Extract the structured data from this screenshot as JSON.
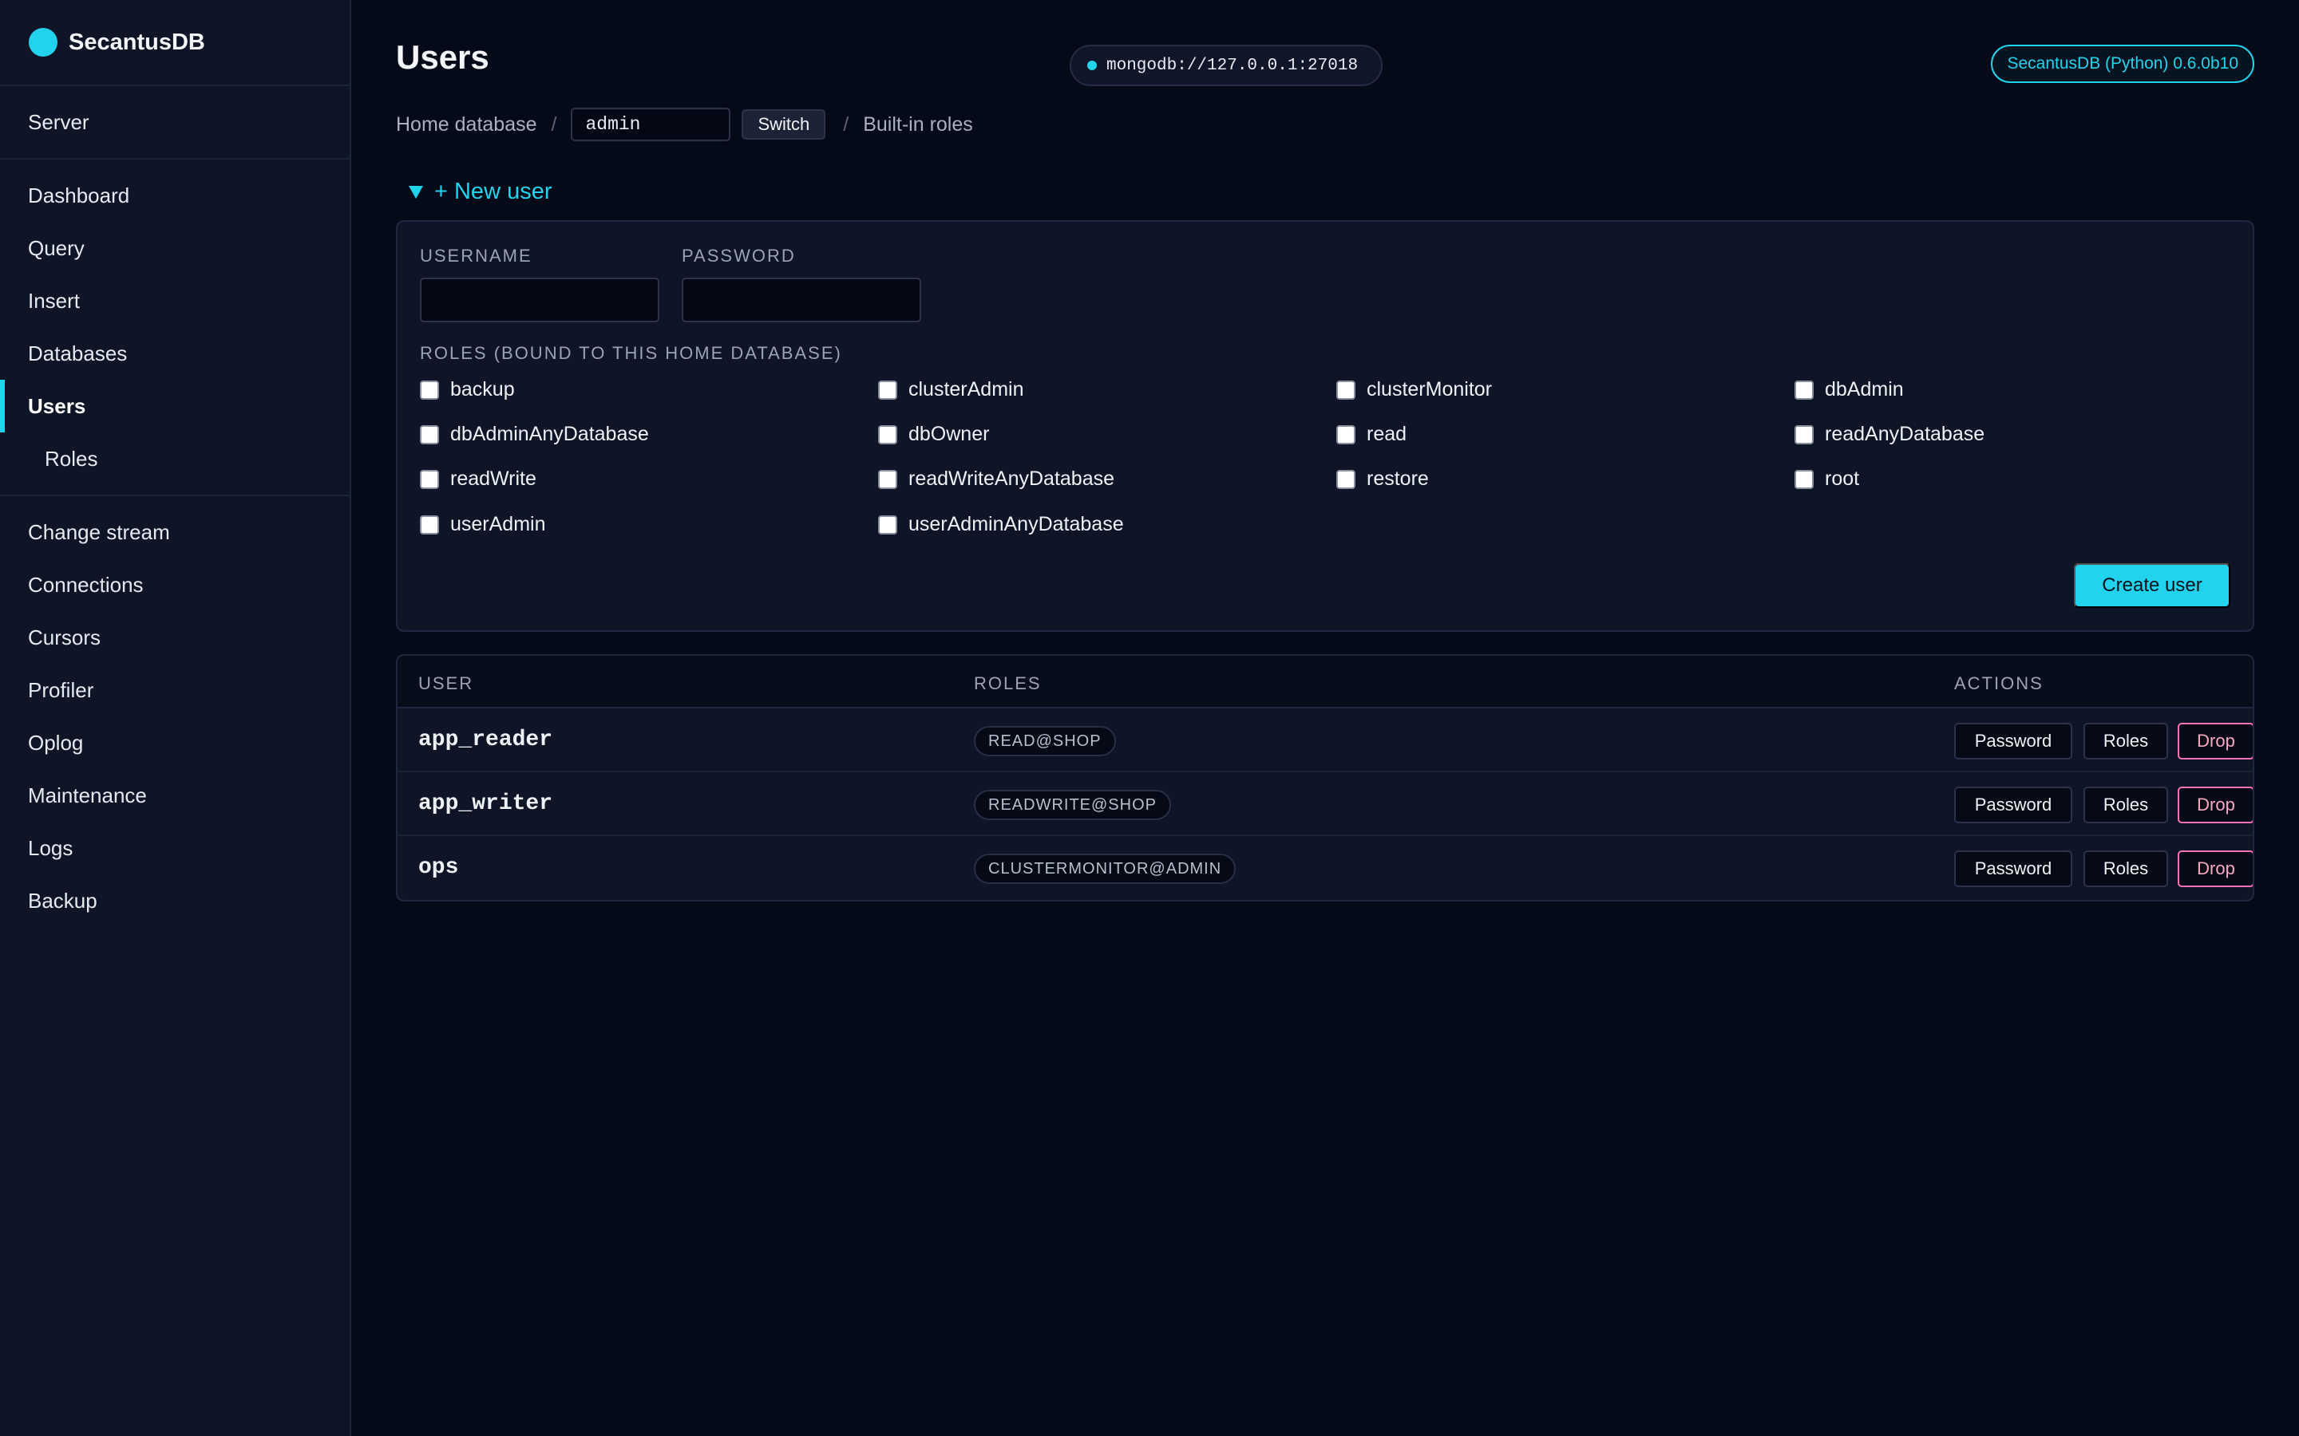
{
  "app": {
    "name": "SecantusDB",
    "version": "SecantusDB (Python) 0.6.0b10"
  },
  "connection": {
    "uri": "mongodb://127.0.0.1:27018"
  },
  "sidebar": {
    "server": "Server",
    "items": [
      {
        "label": "Dashboard"
      },
      {
        "label": "Query"
      },
      {
        "label": "Insert"
      },
      {
        "label": "Databases"
      },
      {
        "label": "Users"
      },
      {
        "label": "Roles"
      }
    ],
    "bottom_items": [
      {
        "label": "Change stream"
      },
      {
        "label": "Connections"
      },
      {
        "label": "Cursors"
      },
      {
        "label": "Profiler"
      },
      {
        "label": "Oplog"
      },
      {
        "label": "Maintenance"
      },
      {
        "label": "Logs"
      },
      {
        "label": "Backup"
      }
    ]
  },
  "page": {
    "title": "Users"
  },
  "breadcrumb": {
    "home_label": "Home database",
    "db_value": "admin",
    "switch_label": "Switch",
    "builtin_label": "Built-in roles"
  },
  "new_user": {
    "toggle_label": "+ New user",
    "username_label": "USERNAME",
    "password_label": "PASSWORD",
    "roles_label": "ROLES (BOUND TO THIS HOME DATABASE)",
    "roles": [
      "backup",
      "clusterAdmin",
      "clusterMonitor",
      "dbAdmin",
      "dbAdminAnyDatabase",
      "dbOwner",
      "read",
      "readAnyDatabase",
      "readWrite",
      "readWriteAnyDatabase",
      "restore",
      "root",
      "userAdmin",
      "userAdminAnyDatabase"
    ],
    "create_label": "Create user"
  },
  "users_table": {
    "headers": {
      "user": "USER",
      "roles": "ROLES",
      "actions": "ACTIONS"
    },
    "rows": [
      {
        "user": "app_reader",
        "role": "READ@SHOP"
      },
      {
        "user": "app_writer",
        "role": "READWRITE@SHOP"
      },
      {
        "user": "ops",
        "role": "CLUSTERMONITOR@ADMIN"
      }
    ],
    "actions": {
      "password": "Password",
      "roles": "Roles",
      "drop": "Drop"
    }
  },
  "colors": {
    "accent": "#22d3ee",
    "danger": "#f472b6",
    "background": "#050a18",
    "sidebar": "#0e1527"
  }
}
